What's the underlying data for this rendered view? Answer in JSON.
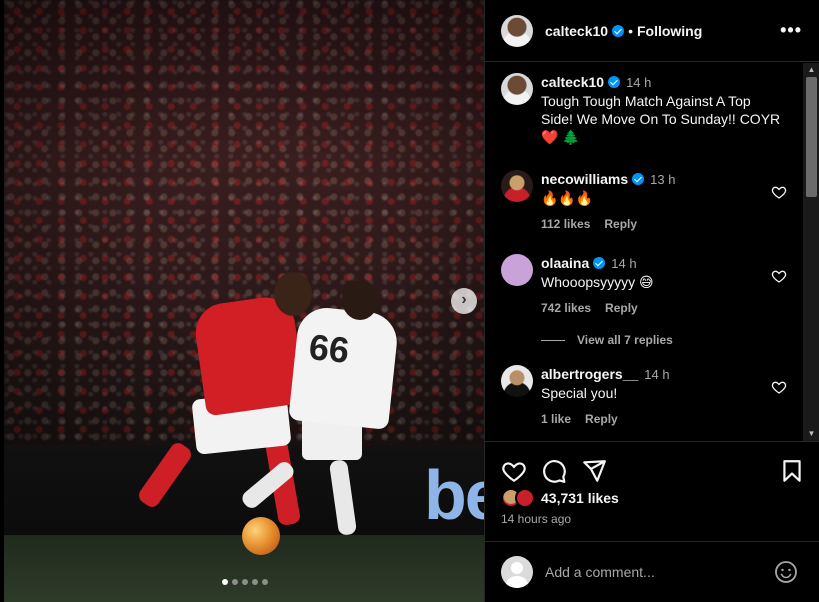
{
  "post": {
    "username": "calteck10",
    "separator": "•",
    "follow_status": "Following",
    "more_label": "•••"
  },
  "media": {
    "jersey_number": "66",
    "board_text": "be",
    "next_label": "›",
    "page_count": 5,
    "current_page": 1
  },
  "caption": {
    "username": "calteck10",
    "time": "14 h",
    "text": "Tough Tough Match Against A Top Side! We Move On To Sunday!! COYR ❤️ 🌲"
  },
  "comments": [
    {
      "username": "necowilliams",
      "verified": true,
      "time": "13 h",
      "text": "🔥🔥🔥",
      "likes": "112 likes",
      "reply": "Reply"
    },
    {
      "username": "olaaina",
      "verified": true,
      "time": "14 h",
      "text": "Whooopsyyyyy 😅",
      "likes": "742 likes",
      "reply": "Reply",
      "replies_label": "View all 7 replies"
    },
    {
      "username": "albertrogers__",
      "verified": false,
      "time": "14 h",
      "text": "Special you!",
      "likes": "1 like",
      "reply": "Reply"
    }
  ],
  "actions": {
    "likes_count": "43,731 likes",
    "time_ago": "14 hours ago"
  },
  "compose": {
    "placeholder": "Add a comment..."
  },
  "colors": {
    "verified": "#0095f6",
    "muted_text": "#a8a8a8",
    "divider": "#262626",
    "nottingham_red": "#d21f26"
  },
  "icons": [
    "more-icon",
    "verified-icon",
    "heart-icon",
    "comment-icon",
    "share-icon",
    "bookmark-icon",
    "emoji-icon",
    "next-arrow-icon"
  ]
}
